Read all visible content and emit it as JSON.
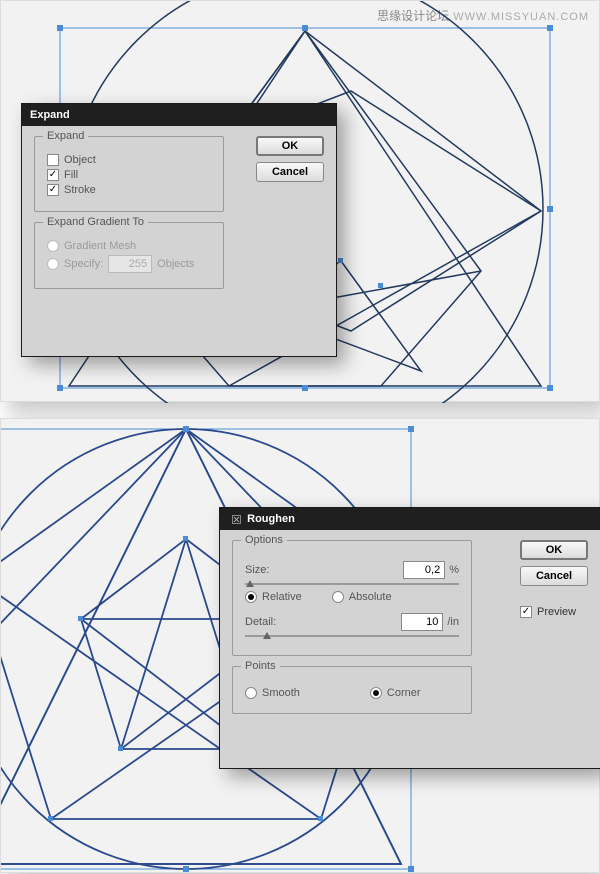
{
  "watermark": {
    "cn": "思缘设计论坛",
    "en": "WWW.MISSYUAN.COM"
  },
  "expand_dialog": {
    "title": "Expand",
    "group1_legend": "Expand",
    "object_label": "Object",
    "fill_label": "Fill",
    "stroke_label": "Stroke",
    "group2_legend": "Expand Gradient To",
    "gradient_mesh_label": "Gradient Mesh",
    "specify_label": "Specify:",
    "specify_value": "255",
    "specify_unit": "Objects",
    "ok_label": "OK",
    "cancel_label": "Cancel"
  },
  "roughen_dialog": {
    "title": "Roughen",
    "options_legend": "Options",
    "size_label": "Size:",
    "size_value": "0,2",
    "size_unit": "%",
    "relative_label": "Relative",
    "absolute_label": "Absolute",
    "detail_label": "Detail:",
    "detail_value": "10",
    "detail_unit": "/in",
    "points_legend": "Points",
    "smooth_label": "Smooth",
    "corner_label": "Corner",
    "ok_label": "OK",
    "cancel_label": "Cancel",
    "preview_label": "Preview"
  }
}
